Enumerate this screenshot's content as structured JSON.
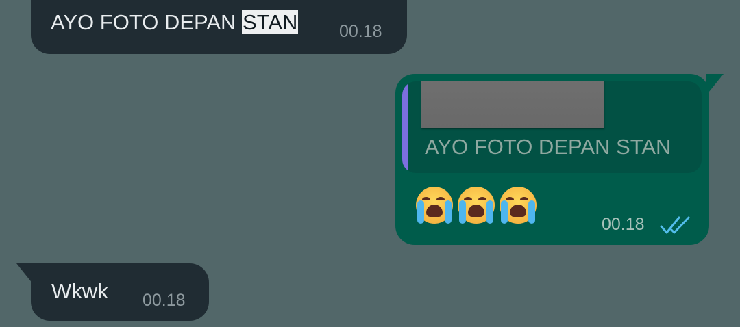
{
  "chat": {
    "messages": [
      {
        "direction": "incoming",
        "text_before_highlight": "AYO FOTO DEPAN ",
        "highlighted_text": "STAN",
        "time": "00.18"
      },
      {
        "direction": "outgoing",
        "quoted": {
          "text": "AYO FOTO DEPAN STAN",
          "author_redacted": true
        },
        "emojis": [
          "loudly-crying-face",
          "loudly-crying-face",
          "loudly-crying-face"
        ],
        "time": "00.18",
        "status": "read",
        "status_icon": "double-check-icon"
      },
      {
        "direction": "incoming",
        "text": "Wkwk",
        "time": "00.18"
      }
    ]
  },
  "colors": {
    "background": "#526769",
    "incoming_bubble": "#202c33",
    "outgoing_bubble": "#005c4b",
    "quote_bar": "#7c6fe0",
    "read_tick": "#53bdeb"
  }
}
